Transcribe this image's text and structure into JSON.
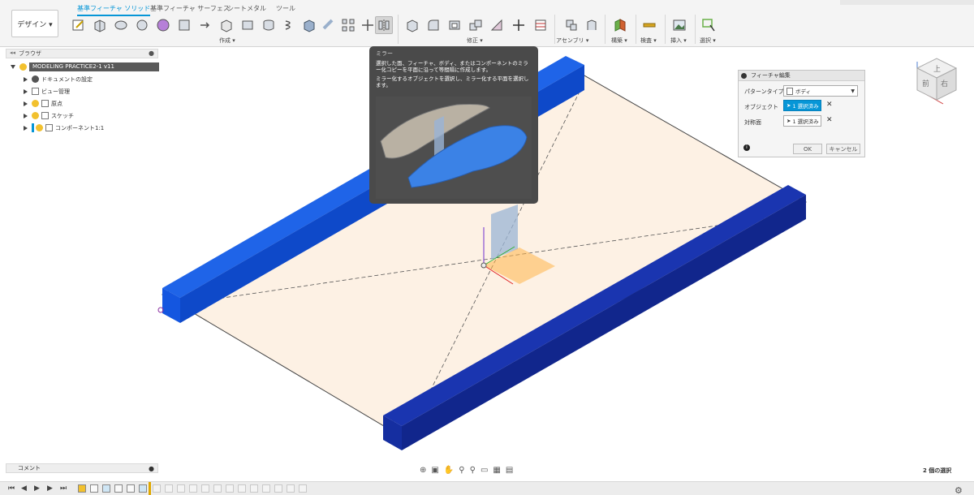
{
  "ribbon": {
    "design_label": "デザイン ▾",
    "tabs": [
      "基準フィーチャ ソリッド",
      "基準フィーチャ サーフェス",
      "シートメタル",
      "ツール"
    ],
    "groups": [
      "作成 ▾",
      "修正 ▾",
      "アセンブリ ▾",
      "構築 ▾",
      "検査 ▾",
      "挿入 ▾",
      "選択 ▾"
    ]
  },
  "browser": {
    "title": "ブラウザ",
    "root": "MODELING PRACTICE2-1 v11",
    "items": [
      "ドキュメントの設定",
      "ビュー管理",
      "原点",
      "スケッチ",
      "コンポーネント1:1"
    ]
  },
  "comment_label": "コメント",
  "tooltip": {
    "title": "ミラー",
    "p1": "選択した面、フィーチャ、ボディ、またはコンポーネントのミラー化コピーを平面に沿って等間隔に作成します。",
    "p2": "ミラー化するオブジェクトを選択し、ミラー化する平面を選択します。"
  },
  "dialog": {
    "title": "フィーチャ編集",
    "pattern_type_label": "パターンタイプ",
    "pattern_type_value": "ボディ",
    "object_label": "オブジェクト",
    "object_value": "1 選択済み",
    "plane_label": "対称面",
    "plane_value": "1 選択済み",
    "ok": "OK",
    "cancel": "キャンセル"
  },
  "status_text": "2 個の選択",
  "viewcube": {
    "front": "前",
    "right": "右",
    "top": "上"
  },
  "colors": {
    "accent": "#0696d7",
    "body_blue": "#1456e0",
    "body_navy": "#152ea0",
    "plate": "#fdf1e4"
  }
}
